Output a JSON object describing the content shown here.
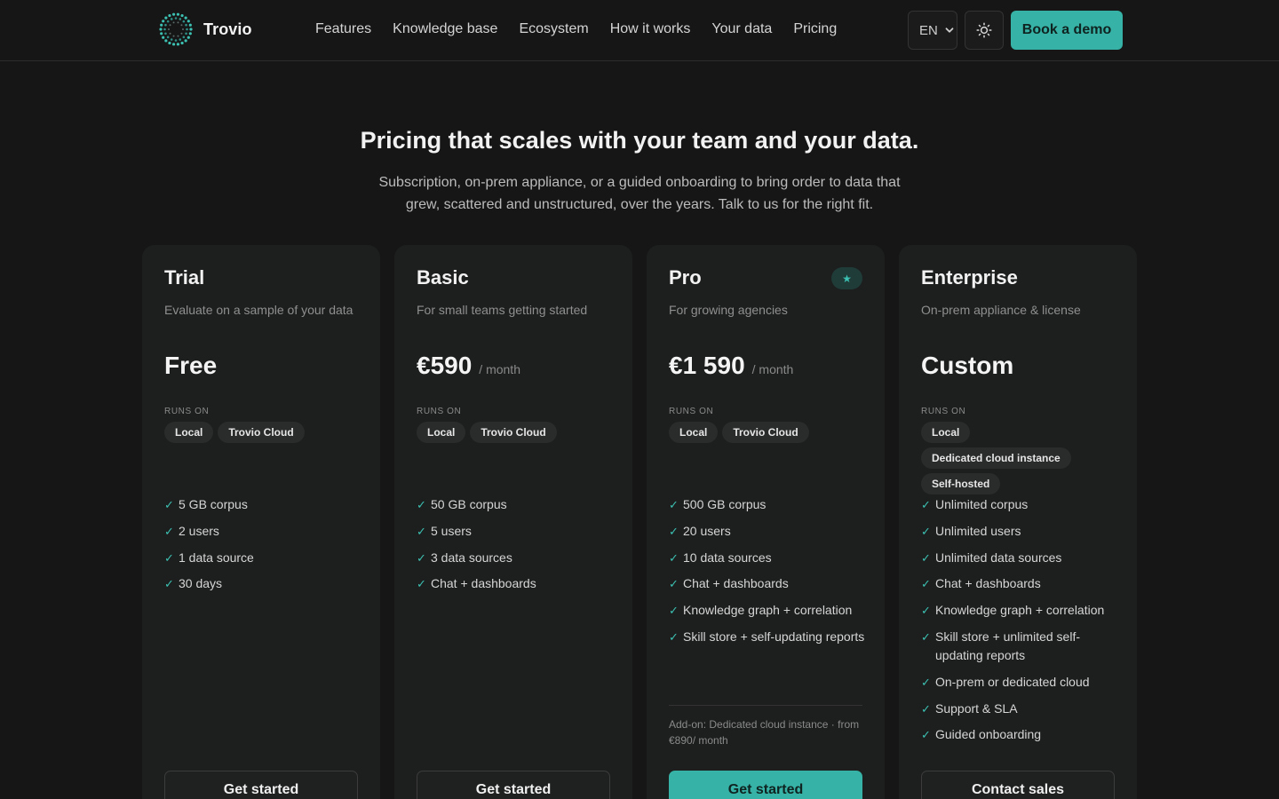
{
  "brand": {
    "name": "Trovio",
    "accent": "#36b3a6"
  },
  "nav": {
    "items": [
      "Features",
      "Knowledge base",
      "Ecosystem",
      "How it works",
      "Your data",
      "Pricing"
    ]
  },
  "header": {
    "language": "EN",
    "theme_icon": "sun-icon",
    "demo_label": "Book a demo"
  },
  "hero": {
    "title": "Pricing that scales with your team and your data.",
    "subtitle": "Subscription, on-prem appliance, or a guided onboarding to bring order to data that grew, scattered and unstructured, over the years. Talk to us for the right fit."
  },
  "runs_on_label": "RUNS ON",
  "plans": [
    {
      "name": "Trial",
      "description": "Evaluate on a sample of your data",
      "price": "Free",
      "period": "",
      "tags": [
        "Local",
        "Trovio Cloud"
      ],
      "features": [
        "5 GB corpus",
        "2 users",
        "1 data source",
        "30 days"
      ],
      "cta": "Get started"
    },
    {
      "name": "Basic",
      "description": "For small teams getting started",
      "price": "€590",
      "period": "/ month",
      "tags": [
        "Local",
        "Trovio Cloud"
      ],
      "features": [
        "50 GB corpus",
        "5 users",
        "3 data sources",
        "Chat + dashboards"
      ],
      "cta": "Get started"
    },
    {
      "name": "Pro",
      "description": "For growing agencies",
      "price": "€1 590",
      "period": "/ month",
      "badge": "★",
      "tags": [
        "Local",
        "Trovio Cloud"
      ],
      "features": [
        "500 GB corpus",
        "20 users",
        "10 data sources",
        "Chat + dashboards",
        "Knowledge graph + correlation",
        "Skill store + self-updating reports"
      ],
      "addon": "Add-on: Dedicated cloud instance · from €890/ month",
      "cta": "Get started"
    },
    {
      "name": "Enterprise",
      "description": "On-prem appliance & license",
      "price": "Custom",
      "period": "",
      "tags": [
        "Local",
        "Dedicated cloud instance",
        "Self-hosted"
      ],
      "features": [
        "Unlimited corpus",
        "Unlimited users",
        "Unlimited data sources",
        "Chat + dashboards",
        "Knowledge graph + correlation",
        "Skill store + unlimited self-updating reports",
        "On-prem or dedicated cloud",
        "Support & SLA",
        "Guided onboarding"
      ],
      "cta": "Contact sales"
    }
  ]
}
